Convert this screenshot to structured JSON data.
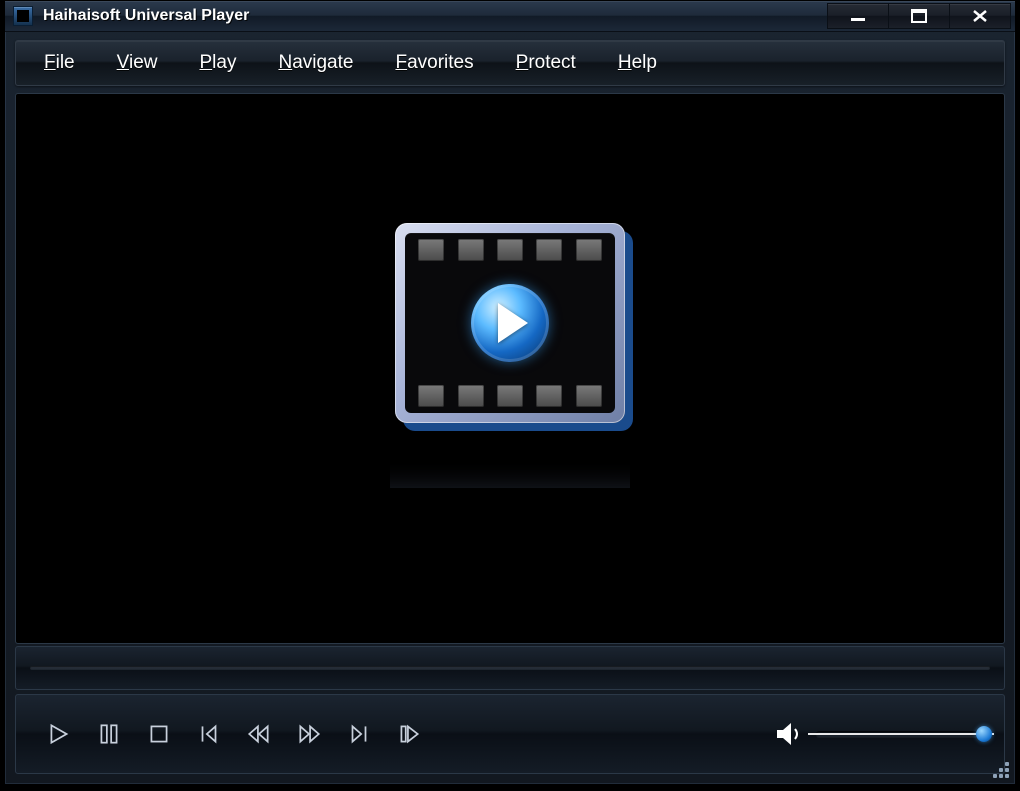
{
  "window": {
    "title": "Haihaisoft Universal Player"
  },
  "menu": {
    "file": "File",
    "view": "View",
    "play": "Play",
    "navigate": "Navigate",
    "favorites": "Favorites",
    "protect": "Protect",
    "help": "Help"
  },
  "controls": {
    "play": "Play",
    "pause": "Pause",
    "stop": "Stop",
    "skip_back": "Skip Back",
    "rewind": "Rewind",
    "forward": "Forward",
    "skip_forward": "Skip Forward",
    "step": "Step Frame"
  },
  "volume": {
    "level_percent": 100
  },
  "seek": {
    "position_percent": 0
  },
  "colors": {
    "accent_blue": "#1a78d4",
    "panel_dark": "#111820",
    "border": "#2b3847"
  }
}
